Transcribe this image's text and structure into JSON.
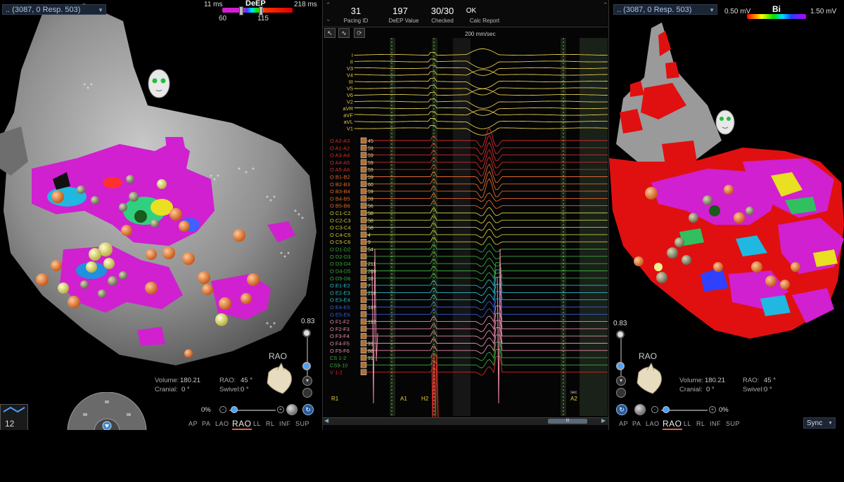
{
  "left_view": {
    "dropdown_label": ".. (3087, 0 Resp. 503)",
    "scale_title": "DeEP",
    "scale_min": "11 ms",
    "scale_max": "218 ms",
    "scale_lo": "60",
    "scale_hi": "115",
    "opacity_value": "0.83",
    "info": {
      "volume_label": "Volume:",
      "volume_value": "180.21",
      "rao_label": "RAO:",
      "rao_value": "45 °",
      "cranial_label": "Cranial:",
      "cranial_value": "0 °",
      "swivel_label": "Swivel:",
      "swivel_value": "0 °"
    },
    "orientation_label": "RAO",
    "zoom_percent": "0%",
    "views": [
      "AP",
      "PA",
      "LAO",
      "RAO",
      "LL",
      "RL",
      "INF",
      "SUP"
    ],
    "active_view": "RAO",
    "mini_value": "12"
  },
  "center": {
    "pacing_id": {
      "value": "31",
      "label": "Pacing ID"
    },
    "deep_value": {
      "value": "197",
      "label": "DeEP Value"
    },
    "checked": {
      "value": "30/30",
      "label": "Checked"
    },
    "calc": {
      "value": "OK",
      "label": "Calc Report"
    },
    "speed": "200 mm/sec",
    "surface_leads": [
      "I",
      "II",
      "V3",
      "V4",
      "III",
      "V5",
      "V6",
      "V2",
      "aVR",
      "aVF",
      "aVL",
      "V1"
    ],
    "catheter_leads": [
      "O A2-A3",
      "O A1-A2",
      "O A3-A4",
      "O A4-A5",
      "O A5-A6",
      "O B1-B2",
      "O B2-B3",
      "O B3-B4",
      "O B4-B5",
      "O B5-B6",
      "O C1-C2",
      "O C2-C3",
      "O C3-C4",
      "O C4-C5",
      "O C5-C6",
      "O D1-D2",
      "O D2-D3",
      "O D3-D4",
      "O D4-D5",
      "O D5-D6",
      "O E1-E2",
      "O E2-E3",
      "O E3-E4",
      "O E4-E5",
      "O E5-E6",
      "O F1-F2",
      "O F2-F3",
      "O F3-F4",
      "O F4-F5",
      "O F5-F6",
      "CS 1-2",
      "CS9-10",
      "V 1-2"
    ],
    "deep_values": [
      "45",
      "59",
      "59",
      "59",
      "59",
      "59",
      "60",
      "59",
      "59",
      "56",
      "58",
      "58",
      "58",
      "4",
      "9",
      "54",
      "",
      "211",
      "209",
      "10",
      "7",
      "218",
      "",
      "197",
      "",
      "192",
      "",
      "",
      "91",
      "88",
      "91"
    ],
    "markers": [
      "R1",
      "A1",
      "H2",
      "A2"
    ],
    "scroll_label": "III",
    "time_label": "sec"
  },
  "right_view": {
    "dropdown_label": ".. (3087, 0 Resp. 503)",
    "scale_title": "Bi",
    "scale_min": "0.50 mV",
    "scale_max": "1.50 mV",
    "opacity_value": "0.83",
    "info": {
      "volume_label": "Volume:",
      "volume_value": "180.21",
      "rao_label": "RAO:",
      "rao_value": "45 °",
      "cranial_label": "Cranial:",
      "cranial_value": "0 °",
      "swivel_label": "Swivel:",
      "swivel_value": "0 °"
    },
    "orientation_label": "RAO",
    "zoom_percent": "0%",
    "views": [
      "AP",
      "PA",
      "LAO",
      "RAO",
      "LL",
      "RL",
      "INF",
      "SUP"
    ],
    "active_view": "RAO",
    "sync_label": "Sync"
  },
  "colors": {
    "trace_yellow": "#e0c84a",
    "trace_red": "#d22a2a",
    "trace_orange": "#e0682a",
    "trace_yellowgreen": "#c8c83a",
    "trace_green": "#3aa83a",
    "trace_blue": "#3a5ad2",
    "trace_cyan": "#2ab8c8",
    "trace_pink": "#e88aa8",
    "map_magenta": "#d020d0",
    "map_red": "#e01010",
    "shell_gray": "#9a9a9a"
  }
}
